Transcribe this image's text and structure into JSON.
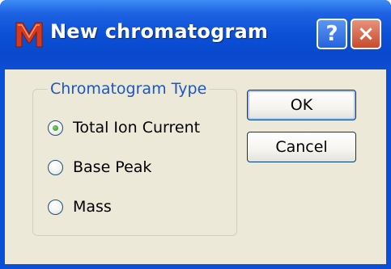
{
  "window": {
    "title": "New chromatogram",
    "help_glyph": "?",
    "close_glyph": "×"
  },
  "group": {
    "title": "Chromatogram Type",
    "options": [
      {
        "label": "Total Ion Current",
        "selected": true
      },
      {
        "label": "Base Peak",
        "selected": false
      },
      {
        "label": "Mass",
        "selected": false
      }
    ]
  },
  "buttons": {
    "ok": "OK",
    "cancel": "Cancel"
  },
  "colors": {
    "titlebar": "#0a4fd8",
    "client": "#ece9d8",
    "group_title": "#1c56c4",
    "close_button": "#c84b2e",
    "app_icon": "#d63a1e"
  }
}
